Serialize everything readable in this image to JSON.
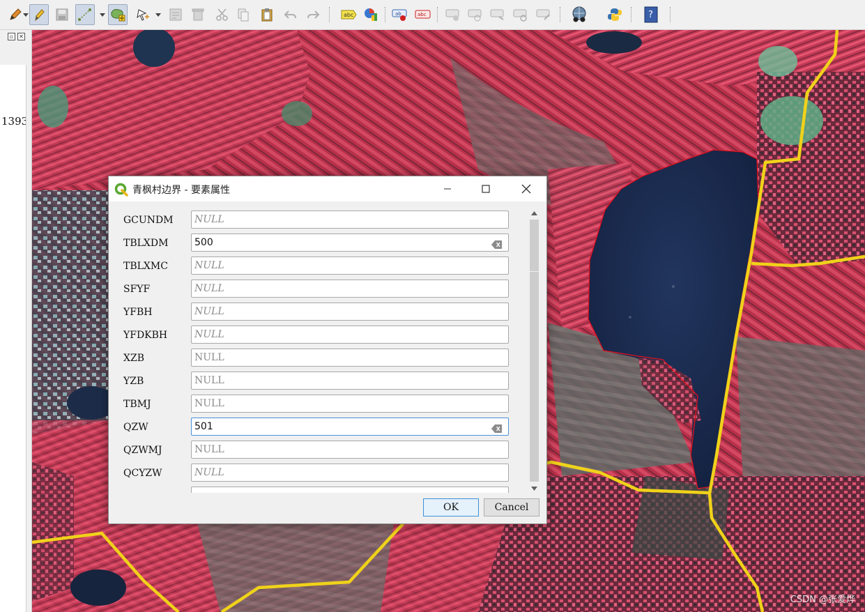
{
  "toolbar": {
    "buttons": [
      {
        "name": "digitize-pencil-icon",
        "tip": ""
      },
      {
        "name": "toggle-editing-icon"
      },
      {
        "name": "save-edits-icon"
      },
      {
        "name": "digitize-line-icon"
      },
      {
        "name": "add-polygon-icon"
      },
      {
        "name": "vertex-tool-icon"
      },
      {
        "name": "modify-attributes-icon"
      },
      {
        "name": "delete-selected-icon"
      },
      {
        "name": "cut-icon"
      },
      {
        "name": "copy-icon"
      },
      {
        "name": "paste-icon"
      },
      {
        "name": "undo-icon"
      },
      {
        "name": "redo-icon"
      },
      {
        "name": "label-abc-icon",
        "text": "abc"
      },
      {
        "name": "diagram-icon"
      },
      {
        "name": "pin-label-icon",
        "text": "ab"
      },
      {
        "name": "hide-label-icon",
        "text": "abc"
      },
      {
        "name": "label-move-icon"
      },
      {
        "name": "label-show-icon"
      },
      {
        "name": "label-rotate-icon"
      },
      {
        "name": "label-change-icon"
      },
      {
        "name": "label-edit-icon"
      },
      {
        "name": "plugin-globe-icon"
      },
      {
        "name": "python-icon"
      },
      {
        "name": "help-icon",
        "text": "?"
      }
    ]
  },
  "left_panel": {
    "value": "1393"
  },
  "map": {
    "watermark": "CSDN @张爱烨"
  },
  "dialog": {
    "title": "青枫村边界 - 要素属性",
    "fields": [
      {
        "label": "GCUNDM",
        "value": "NULL",
        "style": "null"
      },
      {
        "label": "TBLXDM",
        "value": "500",
        "style": "value"
      },
      {
        "label": "TBLXMC",
        "value": "NULL",
        "style": "null"
      },
      {
        "label": "SFYF",
        "value": "NULL",
        "style": "null"
      },
      {
        "label": "YFBH",
        "value": "NULL",
        "style": "null"
      },
      {
        "label": "YFDKBH",
        "value": "NULL",
        "style": "null"
      },
      {
        "label": "XZB",
        "value": "NULL",
        "style": "null-plain"
      },
      {
        "label": "YZB",
        "value": "NULL",
        "style": "null-plain"
      },
      {
        "label": "TBMJ",
        "value": "NULL",
        "style": "null-plain"
      },
      {
        "label": "QZW",
        "value": "501",
        "style": "value"
      },
      {
        "label": "QZWMJ",
        "value": "NULL",
        "style": "null-plain"
      },
      {
        "label": "QCYZW",
        "value": "NULL",
        "style": "null"
      },
      {
        "label": "",
        "value": "",
        "style": "null"
      }
    ],
    "ok_label": "OK",
    "cancel_label": "Cancel"
  }
}
